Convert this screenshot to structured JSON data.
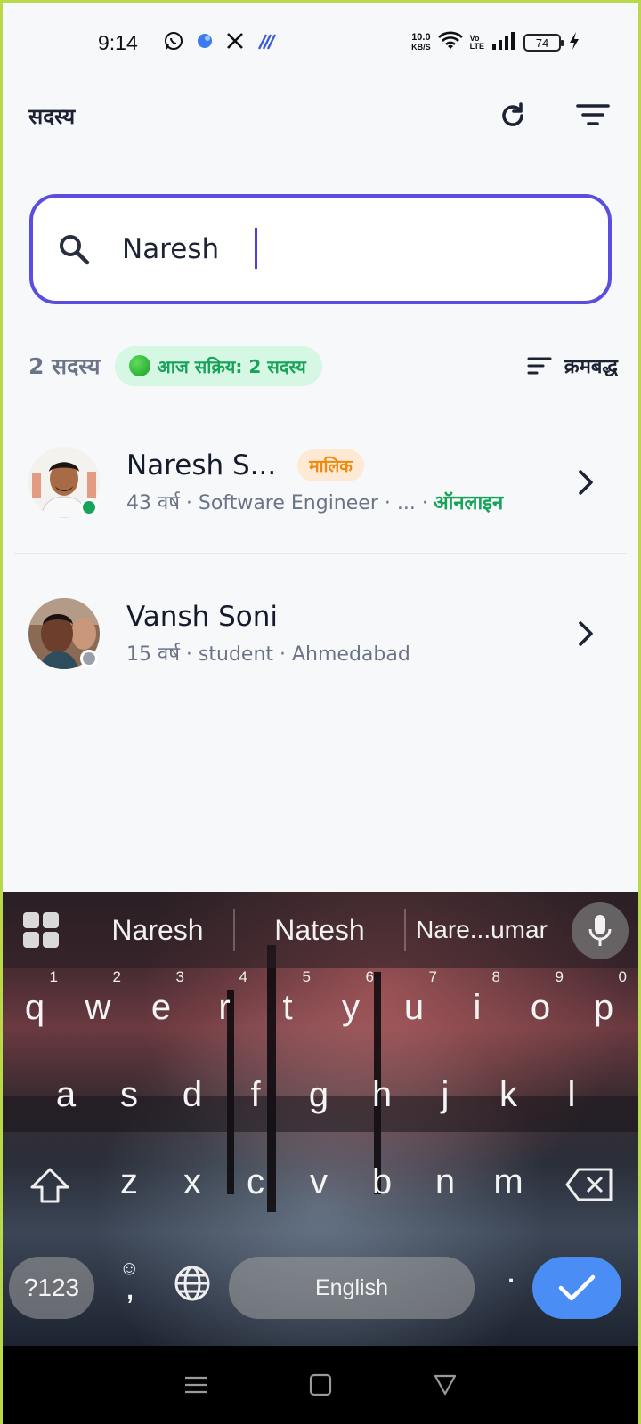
{
  "status_bar": {
    "time": "9:14",
    "net_speed_value": "10.0",
    "net_speed_unit": "KB/S",
    "volte_top": "Vo",
    "volte_bottom": "LTE",
    "battery": "74"
  },
  "header": {
    "title": "सदस्य"
  },
  "search": {
    "value": "Naresh"
  },
  "summary": {
    "count": "2 सदस्य",
    "active_today": "आज सक्रिय: 2 सदस्य",
    "sort_label": "क्रमबद्ध"
  },
  "members": [
    {
      "name": "Naresh S...",
      "badge": "मालिक",
      "details": "43 वर्ष · Software Engineer · ... ·",
      "status": "ऑनलाइन",
      "status_color": "#17a35a"
    },
    {
      "name": "Vansh Soni",
      "details": "15 वर्ष · student · Ahmedabad",
      "status_color": "#9aa0aa"
    }
  ],
  "keyboard": {
    "suggestions": [
      "Naresh",
      "Natesh",
      "Nare...umar"
    ],
    "row1": [
      {
        "k": "q",
        "n": "1"
      },
      {
        "k": "w",
        "n": "2"
      },
      {
        "k": "e",
        "n": "3"
      },
      {
        "k": "r",
        "n": "4"
      },
      {
        "k": "t",
        "n": "5"
      },
      {
        "k": "y",
        "n": "6"
      },
      {
        "k": "u",
        "n": "7"
      },
      {
        "k": "i",
        "n": "8"
      },
      {
        "k": "o",
        "n": "9"
      },
      {
        "k": "p",
        "n": "0"
      }
    ],
    "row2": [
      "a",
      "s",
      "d",
      "f",
      "g",
      "h",
      "j",
      "k",
      "l"
    ],
    "row3": [
      "z",
      "x",
      "c",
      "v",
      "b",
      "n",
      "m"
    ],
    "symbols_label": "?123",
    "comma_label": ",",
    "space_label": "English",
    "period_label": "."
  },
  "colors": {
    "accent": "#5b4de0",
    "online": "#17a35a",
    "owner_badge": "#f08a0c",
    "done_key": "#4a8ef5"
  }
}
